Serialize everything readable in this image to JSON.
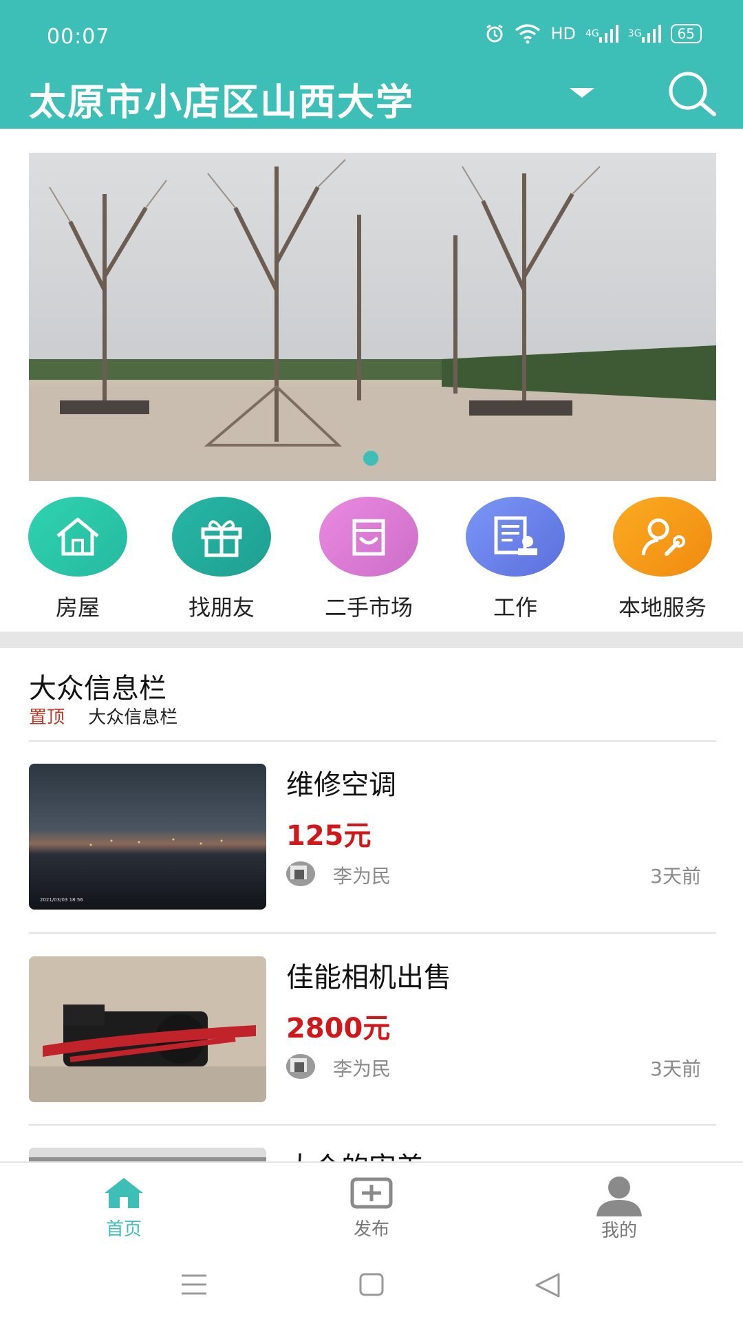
{
  "status_bar": {
    "time": "00:07",
    "network_label": "HD",
    "signal_4g": "4G",
    "signal_3g": "3G",
    "battery": "65"
  },
  "header": {
    "location": "太原市小店区山西大学",
    "accent_color": "#3dbfb8"
  },
  "banner": {
    "page_count": 1,
    "active_index": 0
  },
  "categories": [
    {
      "label": "房屋",
      "icon": "house-icon",
      "color": "#2fc8a8"
    },
    {
      "label": "找朋友",
      "icon": "gift-icon",
      "color": "#22a89a"
    },
    {
      "label": "二手市场",
      "icon": "box-icon",
      "color": "#e07bd8"
    },
    {
      "label": "工作",
      "icon": "document-stamp-icon",
      "color": "#6c84ef"
    },
    {
      "label": "本地服务",
      "icon": "person-wrench-icon",
      "color": "#f59a19"
    }
  ],
  "section": {
    "title": "大众信息栏",
    "pin_label": "置顶",
    "sub_title": "大众信息栏"
  },
  "listings": [
    {
      "title": "维修空调",
      "price": "125元",
      "user": "李为民",
      "time": "3天前"
    },
    {
      "title": "佳能相机出售",
      "price": "2800元",
      "user": "李为民",
      "time": "3天前"
    },
    {
      "title": "大众的审美",
      "price": "",
      "user": "",
      "time": ""
    }
  ],
  "bottom_nav": [
    {
      "label": "首页",
      "icon": "home-icon",
      "active": true
    },
    {
      "label": "发布",
      "icon": "publish-icon",
      "active": false
    },
    {
      "label": "我的",
      "icon": "profile-icon",
      "active": false
    }
  ],
  "thumb_caption": "2021/03/03 18:56"
}
